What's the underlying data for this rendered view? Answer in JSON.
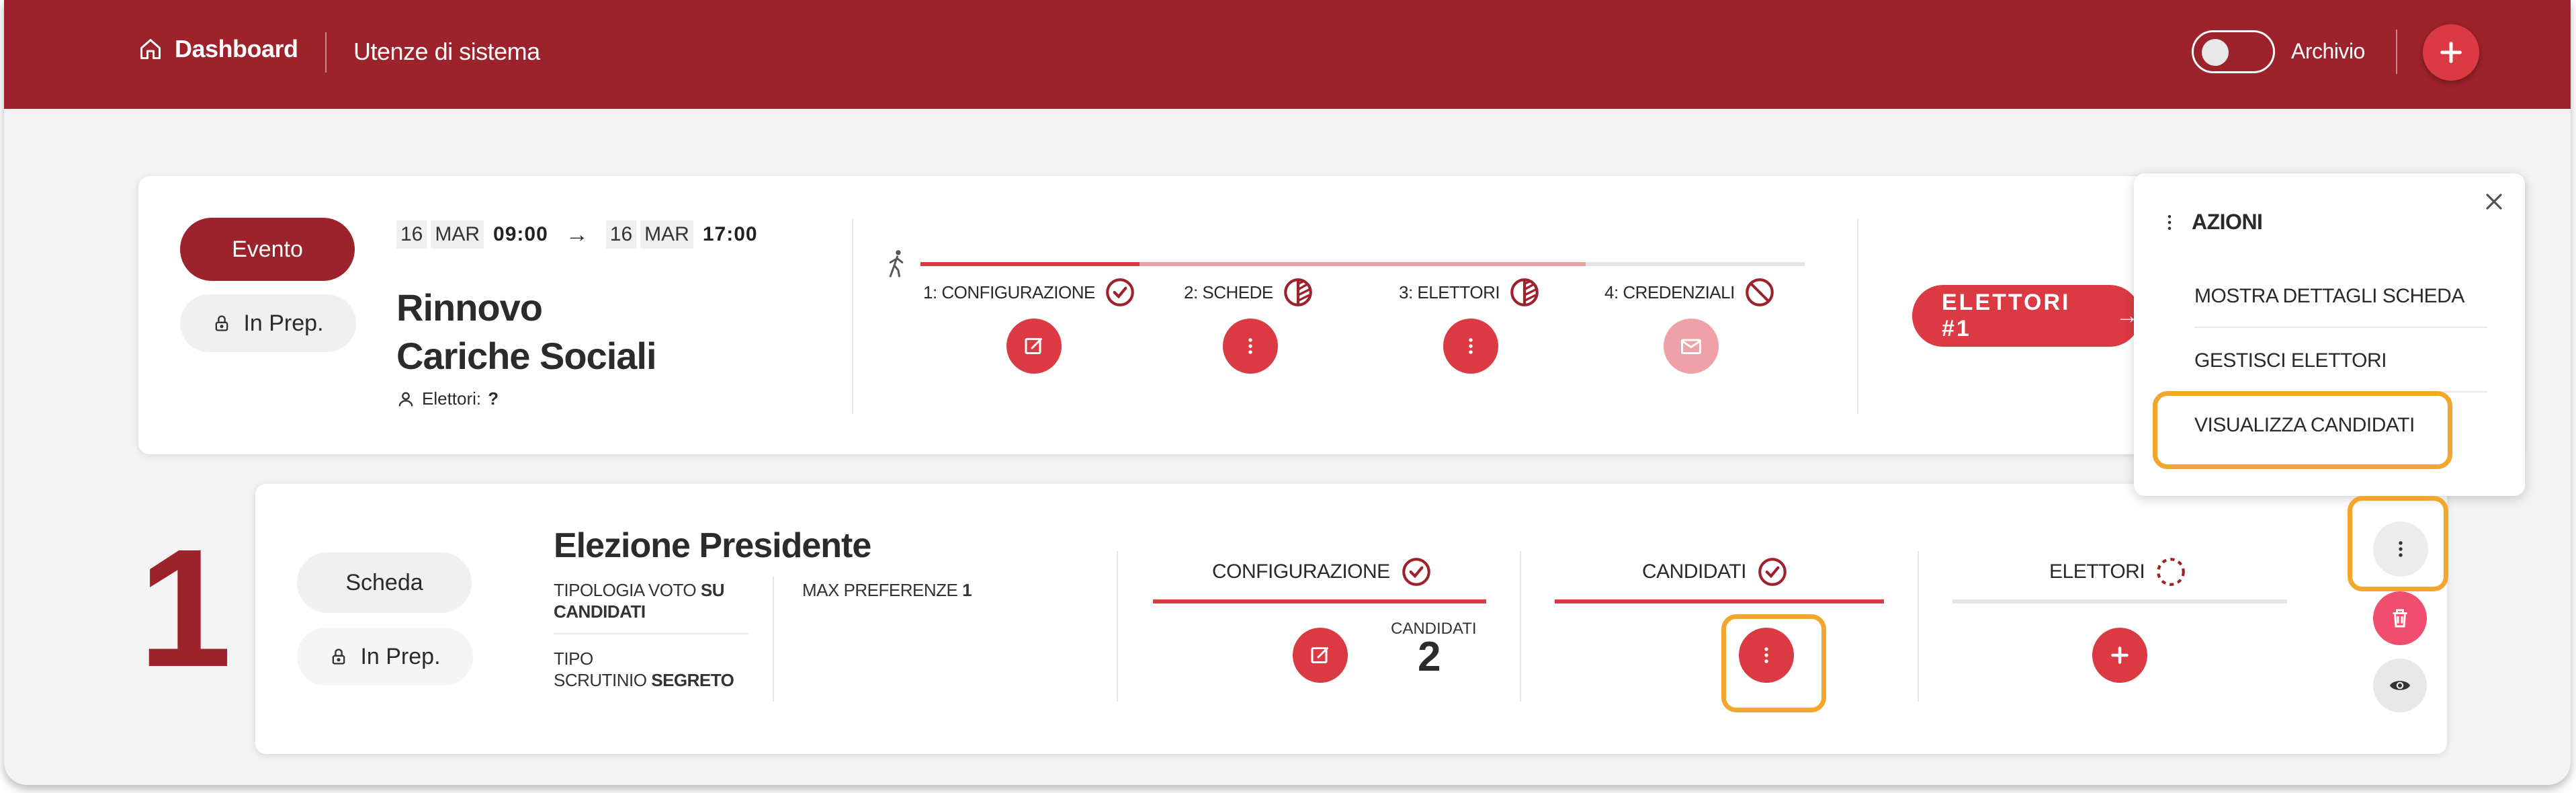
{
  "header": {
    "home_label": "Dashboard",
    "users_label": "Utenze di sistema",
    "archive_label": "Archivio",
    "archive_toggle_on": false,
    "add_icon": "plus-icon"
  },
  "event": {
    "type_label": "Evento",
    "status_label": "In Prep.",
    "start": {
      "day": "16",
      "month": "MAR",
      "time": "09:00"
    },
    "end": {
      "day": "16",
      "month": "MAR",
      "time": "17:00"
    },
    "title_line1": "Rinnovo",
    "title_line2": "Cariche Sociali",
    "electors_label": "Elettori:",
    "electors_value": "?",
    "steps": [
      {
        "label": "1: CONFIGURAZIONE",
        "status_icon": "check-circle-icon",
        "action_icon": "edit-icon"
      },
      {
        "label": "2: SCHEDE",
        "status_icon": "half-circle-icon",
        "action_icon": "more-vertical-icon"
      },
      {
        "label": "3: ELETTORI",
        "status_icon": "half-circle-icon",
        "action_icon": "more-vertical-icon"
      },
      {
        "label": "4: CREDENZIALI",
        "status_icon": "blocked-icon",
        "action_icon": "mail-icon"
      }
    ],
    "electors_button": "ELETTORI #1"
  },
  "actions_menu": {
    "title": "AZIONI",
    "items": [
      "MOSTRA DETTAGLI SCHEDA",
      "GESTISCI ELETTORI",
      "VISUALIZZA CANDIDATI"
    ]
  },
  "ballot": {
    "number": "1",
    "type_label": "Scheda",
    "status_label": "In Prep.",
    "title": "Elezione Presidente",
    "vote_type_label": "TIPOLOGIA VOTO",
    "vote_type_value_1": "SU",
    "vote_type_value_2": "CANDIDATI",
    "max_pref_label": "MAX PREFERENZE",
    "max_pref_value": "1",
    "scrutiny_label_1": "TIPO",
    "scrutiny_label_2": "SCRUTINIO",
    "scrutiny_value": "SEGRETO",
    "columns": [
      {
        "label": "CONFIGURAZIONE",
        "status_icon": "check-circle-icon"
      },
      {
        "label": "CANDIDATI",
        "status_icon": "check-circle-icon"
      },
      {
        "label": "ELETTORI",
        "status_icon": "dashed-circle-icon"
      }
    ],
    "candidates_label": "CANDIDATI",
    "candidates_count": "2"
  },
  "colors": {
    "brand": "#9c222b",
    "accent": "#dc3a43",
    "highlight": "#f0a72c"
  }
}
